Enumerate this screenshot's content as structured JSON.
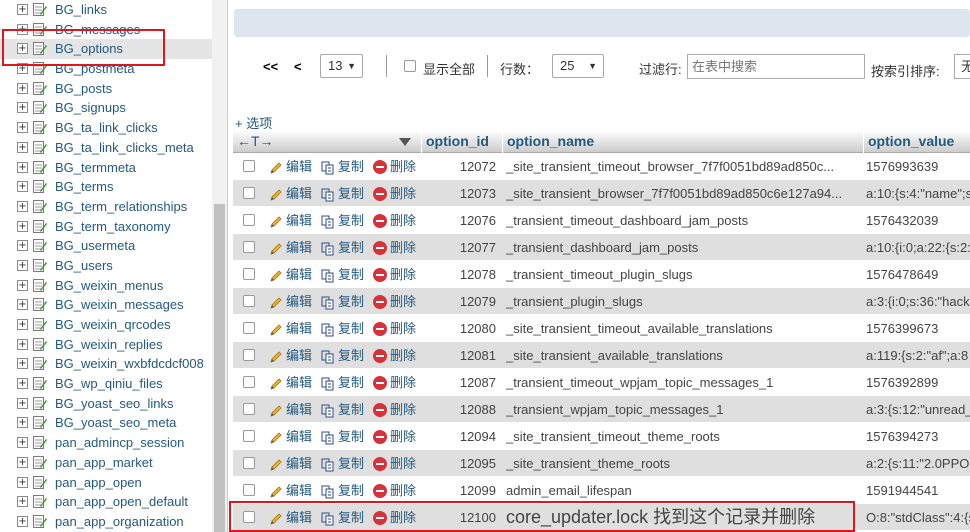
{
  "sidebar": {
    "tables": [
      "BG_links",
      "BG_messages",
      "BG_options",
      "BG_postmeta",
      "BG_posts",
      "BG_signups",
      "BG_ta_link_clicks",
      "BG_ta_link_clicks_meta",
      "BG_termmeta",
      "BG_terms",
      "BG_term_relationships",
      "BG_term_taxonomy",
      "BG_usermeta",
      "BG_users",
      "BG_weixin_menus",
      "BG_weixin_messages",
      "BG_weixin_qrcodes",
      "BG_weixin_replies",
      "BG_weixin_wxbfdcdcf008",
      "BG_wp_qiniu_files",
      "BG_yoast_seo_links",
      "BG_yoast_seo_meta",
      "pan_admincp_session",
      "pan_app_market",
      "pan_app_open",
      "pan_app_open_default",
      "pan_app_organization"
    ],
    "selected": "BG_options",
    "expand_symbol": "+"
  },
  "nav": {
    "first": "<<",
    "prev": "<",
    "page": "13",
    "show_all": "显示全部",
    "rows_label": "行数：",
    "rows_value": "25",
    "filter_label": "过滤行:",
    "filter_placeholder": "在表中搜索",
    "sort_label": "按索引排序:",
    "sort_value": "无"
  },
  "options_link": "+ 选项",
  "columns": {
    "arrows": "←T→",
    "option_id": "option_id",
    "option_name": "option_name",
    "option_value": "option_value"
  },
  "actions": {
    "edit": "编辑",
    "copy": "复制",
    "delete": "删除"
  },
  "rows": [
    {
      "id": "12072",
      "name": "_site_transient_timeout_browser_7f7f0051bd89ad850c...",
      "value": "1576993639"
    },
    {
      "id": "12073",
      "name": "_site_transient_browser_7f7f0051bd89ad850c6e127a94...",
      "value": "a:10:{s:4:\"name\";s"
    },
    {
      "id": "12076",
      "name": "_transient_timeout_dashboard_jam_posts",
      "value": "1576432039"
    },
    {
      "id": "12077",
      "name": "_transient_dashboard_jam_posts",
      "value": "a:10:{i:0;a:22:{s:2:"
    },
    {
      "id": "12078",
      "name": "_transient_timeout_plugin_slugs",
      "value": "1576478649"
    },
    {
      "id": "12079",
      "name": "_transient_plugin_slugs",
      "value": "a:3:{i:0;s:36:\"hack"
    },
    {
      "id": "12080",
      "name": "_site_transient_timeout_available_translations",
      "value": "1576399673"
    },
    {
      "id": "12081",
      "name": "_site_transient_available_translations",
      "value": "a:119:{s:2:\"af\";a:8"
    },
    {
      "id": "12087",
      "name": "_transient_timeout_wpjam_topic_messages_1",
      "value": "1576392899"
    },
    {
      "id": "12088",
      "name": "_transient_wpjam_topic_messages_1",
      "value": "a:3:{s:12:\"unread_"
    },
    {
      "id": "12094",
      "name": "_site_transient_timeout_theme_roots",
      "value": "1576394273"
    },
    {
      "id": "12095",
      "name": "_site_transient_theme_roots",
      "value": "a:2:{s:11:\"2.0PPO"
    },
    {
      "id": "12099",
      "name": "admin_email_lifespan",
      "value": "1591944541"
    },
    {
      "id": "12100",
      "name": "core_updater.lock 找到这个记录并删除",
      "value": "O:8:\"stdClass\":4:{s"
    }
  ]
}
